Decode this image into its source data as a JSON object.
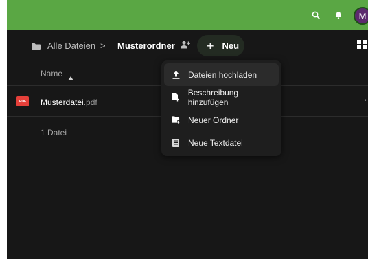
{
  "header": {
    "avatar_initial": "M",
    "accent_color": "#5aa744",
    "icons": [
      "search-icon",
      "bell-icon"
    ]
  },
  "breadcrumb": {
    "root_label": "Alle Dateien",
    "separator": ">",
    "current_label": "Musterordner",
    "new_button_label": "Neu",
    "new_button_icon": "+"
  },
  "file_list": {
    "column_name": "Name",
    "sort_indicator": "▲",
    "files": [
      {
        "base": "Musterdatei",
        "ext": ".pdf",
        "type_badge": "PDF",
        "more": "⋯"
      }
    ],
    "summary": "1 Datei"
  },
  "new_menu": {
    "items": [
      {
        "label": "Dateien hochladen",
        "icon": "upload-icon"
      },
      {
        "label": "Beschreibung hinzufügen",
        "icon": "file-plus-icon"
      },
      {
        "label": "Neuer Ordner",
        "icon": "folder-plus-icon"
      },
      {
        "label": "Neue Textdatei",
        "icon": "text-file-icon"
      }
    ]
  }
}
